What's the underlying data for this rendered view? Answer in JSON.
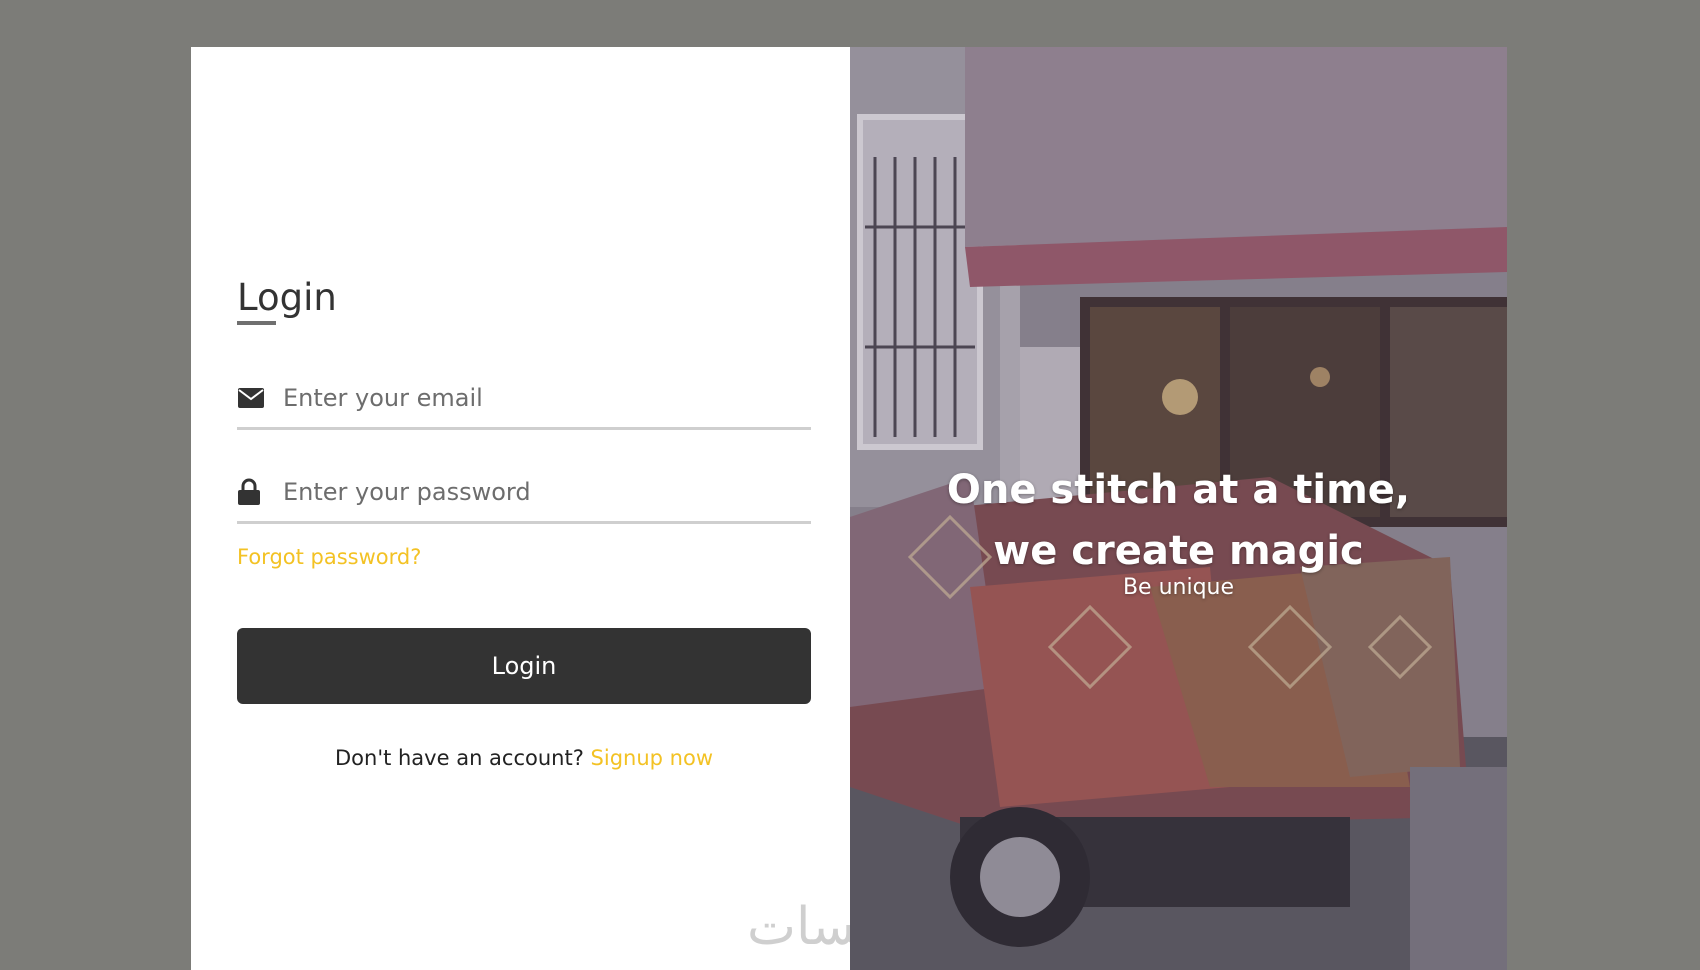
{
  "login": {
    "title": "Login",
    "email_placeholder": "Enter your email",
    "password_placeholder": "Enter your password",
    "forgot_label": "Forgot password?",
    "button_label": "Login",
    "signup_prompt": "Don't have an account?",
    "signup_link": "Signup now"
  },
  "hero": {
    "line1": "One stitch at a time,",
    "line2": "we create magic",
    "tagline": "Be unique"
  },
  "watermark": "خمسات",
  "colors": {
    "accent": "#f3c224",
    "button": "#333333",
    "background": "#7c7c78"
  },
  "icons": {
    "email": "envelope-icon",
    "password": "lock-icon"
  }
}
